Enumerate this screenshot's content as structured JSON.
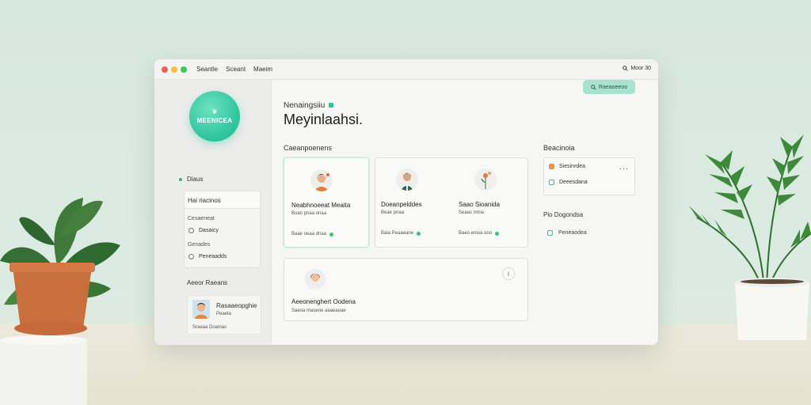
{
  "titlebar": {
    "menu": [
      "Seantle",
      "Sceant",
      "Maeim"
    ],
    "right_label": "Moor 30",
    "dot_colors": [
      "#ee5f57",
      "#f6bd3a",
      "#3ec653"
    ]
  },
  "sidebar": {
    "logo_text": "MEENICEA",
    "status_label": "Diaus",
    "card": {
      "header": "Hai riacinos",
      "group1_label": "Cesaeneat",
      "group1_option": "Dasaicy",
      "group2_label": "Genades",
      "group2_option": "Peneaadds"
    },
    "section_title": "Aeeor Raeans",
    "user": {
      "name": "Rasaaeopghie",
      "subtitle": "Peaeta",
      "meta": "Sraeaa Doanias"
    }
  },
  "main": {
    "accent_button": "Raeaoeeoo",
    "kicker": "Nenaingsiiu",
    "headline": "Meyinlaahsi.",
    "components_title": "Caeanpoenens",
    "cards": [
      {
        "name": "Neabhnoeeat Meaita",
        "role": "Boao pnaa onaa",
        "meta": "Baae oeaa dnaa"
      },
      {
        "name": "Doeanpelddes",
        "role": "Beae pnaa",
        "meta": "Baia Peaaeane"
      },
      {
        "name": "Saao Sioanida",
        "role": "Seaas mtna",
        "meta": "Baeo enioa ooo"
      }
    ],
    "wide_card": {
      "name": "Aeeonenghert Oodena",
      "role": "Saeoa maseoe aaaeaoae"
    },
    "right_title": "Beacinoia",
    "right_rows": [
      "Siesinrdea",
      "Deeesdana"
    ],
    "right_title2": "Pio Dogondsa",
    "right_row3": "Peneaodea",
    "accent_color": "#2cc49b"
  }
}
